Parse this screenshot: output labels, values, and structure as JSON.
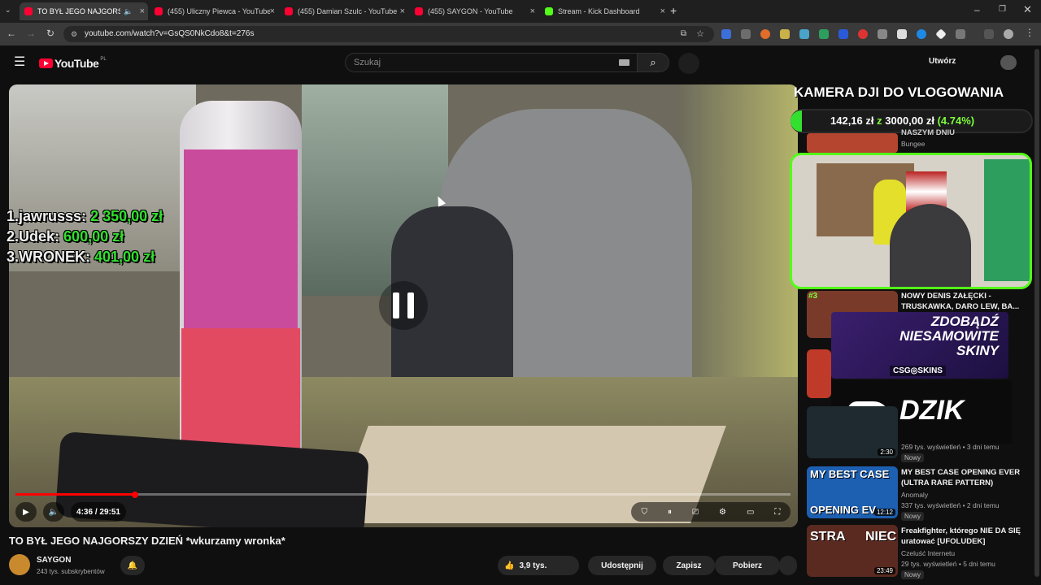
{
  "browser": {
    "tabs": [
      {
        "title": "TO BYŁ JEGO NAJGORSZY D",
        "active": true,
        "favicon_color": "#ff0033"
      },
      {
        "title": "(455) Uliczny Piewca - YouTube",
        "active": false,
        "favicon_color": "#ff0033"
      },
      {
        "title": "(455) Damian Szulc - YouTube",
        "active": false,
        "favicon_color": "#ff0033"
      },
      {
        "title": "(455) SAYGON - YouTube",
        "active": false,
        "favicon_color": "#ff0033"
      },
      {
        "title": "Stream - Kick Dashboard",
        "active": false,
        "favicon_color": "#53fc18"
      }
    ],
    "new_tab": "+",
    "url": "youtube.com/watch?v=GsQS0NkCdo8&t=276s"
  },
  "youtube": {
    "logo_text": "YouTube",
    "logo_region": "PL",
    "search_placeholder": "Szukaj",
    "create_label": "Utwórz"
  },
  "video": {
    "leaderboard": [
      {
        "rank_name": "1.jawrusss:",
        "amount": "2 350,00 zł"
      },
      {
        "rank_name": "2.Udek:",
        "amount": "600,00 zł"
      },
      {
        "rank_name": "3.WRONEK:",
        "amount": "401,00 zł"
      }
    ],
    "time_current": "4:36",
    "time_total": "29:51",
    "progress": 0.1545
  },
  "stream_overlay": {
    "goal_title": "KAMERA DJI DO VLOGOWANIA",
    "goal_current": "142,16 zł",
    "goal_sep": "z",
    "goal_target": "3000,00 zł",
    "goal_percent": "(4.74%)",
    "promo_line1": "ZDOBĄDŹ",
    "promo_line2": "NIESAMOWITE",
    "promo_line3": "SKINY",
    "promo_brand": "CSG◎SKINS",
    "sponsor": "DZIK"
  },
  "below_video": {
    "title": "TO BYŁ JEGO NAJGORSZY DZIEŃ *wkurzamy wronka*",
    "channel": "SAYGON",
    "subscribers": "243 tys. subskrybentów",
    "likes": "3,9 tys.",
    "share": "Udostępnij",
    "save": "Zapisz",
    "download": "Pobierz"
  },
  "sidebar": {
    "partial_items": [
      {
        "title": "NASZYM DNIU",
        "channel": "Bungee"
      },
      {
        "title": "NOWY DENIS ZAŁĘCKI - TRUSKAWKA, DARO LEW, BA...",
        "rank": "#3"
      }
    ],
    "items": [
      {
        "title": "",
        "channel": "",
        "meta": "269 tys. wyświetleń • 3 dni temu",
        "badge": "Nowy",
        "duration": "2:30"
      },
      {
        "title": "MY BEST CASE OPENING EVER (ULTRA RARE PATTERN)",
        "channel": "Anomaly",
        "meta": "337 tys. wyświetleń • 2 dni temu",
        "badge": "Nowy",
        "duration": "12:12",
        "thumb_text1": "MY BEST CASE",
        "thumb_text2": "OPENING EV"
      },
      {
        "title": "Freakfighter, którego NIE DA SIĘ uratować [UFOLUDEK]",
        "channel": "Czeluść Internetu",
        "meta": "29 tys. wyświetleń • 5 dni temu",
        "badge": "Nowy",
        "duration": "23:49",
        "thumb_text1": "STRA",
        "thumb_text2": "NIEC"
      }
    ]
  },
  "colors": {
    "youtube_red": "#ff0033",
    "kick_green": "#53fc18",
    "leader_green": "#33e02f",
    "goal_green": "#7dff3a"
  }
}
